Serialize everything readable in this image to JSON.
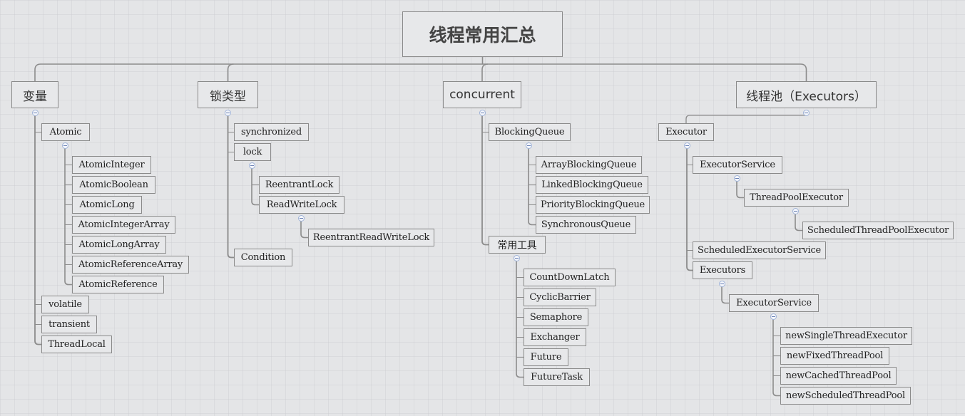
{
  "title": "线程常用汇总",
  "branches": [
    {
      "id": "var",
      "label": "变量",
      "children": [
        {
          "id": "atomic",
          "label": "Atomic",
          "children": [
            {
              "id": "ai",
              "label": "AtomicInteger"
            },
            {
              "id": "ab",
              "label": "AtomicBoolean"
            },
            {
              "id": "al",
              "label": "AtomicLong"
            },
            {
              "id": "aia",
              "label": "AtomicIntegerArray"
            },
            {
              "id": "ala",
              "label": "AtomicLongArray"
            },
            {
              "id": "ara",
              "label": "AtomicReferenceArray"
            },
            {
              "id": "ar",
              "label": "AtomicReference"
            }
          ]
        },
        {
          "id": "volatile",
          "label": "volatile"
        },
        {
          "id": "transient",
          "label": "transient"
        },
        {
          "id": "threadlocal",
          "label": "ThreadLocal"
        }
      ]
    },
    {
      "id": "locks",
      "label": "锁类型",
      "children": [
        {
          "id": "sync",
          "label": "synchronized"
        },
        {
          "id": "lock",
          "label": "lock",
          "children": [
            {
              "id": "rl",
              "label": "ReentrantLock"
            },
            {
              "id": "rwl",
              "label": "ReadWriteLock",
              "children": [
                {
                  "id": "rrwl",
                  "label": "ReentrantReadWriteLock"
                }
              ]
            }
          ]
        },
        {
          "id": "cond",
          "label": "Condition"
        }
      ]
    },
    {
      "id": "conc",
      "label": "concurrent",
      "children": [
        {
          "id": "bq",
          "label": "BlockingQueue",
          "children": [
            {
              "id": "abq",
              "label": "ArrayBlockingQueue"
            },
            {
              "id": "lbq",
              "label": "LinkedBlockingQueue"
            },
            {
              "id": "pbq",
              "label": "PriorityBlockingQueue"
            },
            {
              "id": "sq",
              "label": "SynchronousQueue"
            }
          ]
        },
        {
          "id": "tools",
          "label": "常用工具",
          "children": [
            {
              "id": "cdl",
              "label": "CountDownLatch"
            },
            {
              "id": "cb",
              "label": "CyclicBarrier"
            },
            {
              "id": "sem",
              "label": "Semaphore"
            },
            {
              "id": "exch",
              "label": "Exchanger"
            },
            {
              "id": "fut",
              "label": "Future"
            },
            {
              "id": "ft",
              "label": "FutureTask"
            }
          ]
        }
      ]
    },
    {
      "id": "pool",
      "label": "线程池（Executors）",
      "children": [
        {
          "id": "executor",
          "label": "Executor",
          "children": [
            {
              "id": "es",
              "label": "ExecutorService",
              "children": [
                {
                  "id": "tpe",
                  "label": "ThreadPoolExecutor",
                  "children": [
                    {
                      "id": "stpe",
                      "label": "ScheduledThreadPoolExecutor"
                    }
                  ]
                }
              ]
            },
            {
              "id": "ses",
              "label": "ScheduledExecutorService"
            },
            {
              "id": "executors",
              "label": "Executors",
              "children": [
                {
                  "id": "es2",
                  "label": "ExecutorService",
                  "children": [
                    {
                      "id": "nste",
                      "label": "newSingleThreadExecutor"
                    },
                    {
                      "id": "nftp",
                      "label": "newFixedThreadPool"
                    },
                    {
                      "id": "nctp",
                      "label": "newCachedThreadPool"
                    },
                    {
                      "id": "nstp",
                      "label": "newScheduledThreadPool"
                    }
                  ]
                }
              ]
            }
          ]
        }
      ]
    }
  ],
  "colors": {
    "line": "#8c8c8c",
    "border": "#8a8a8a",
    "toggle": "#9fb3d8",
    "background": "#e4e5e7"
  },
  "icons": {
    "collapse": "minus-circle-icon"
  }
}
